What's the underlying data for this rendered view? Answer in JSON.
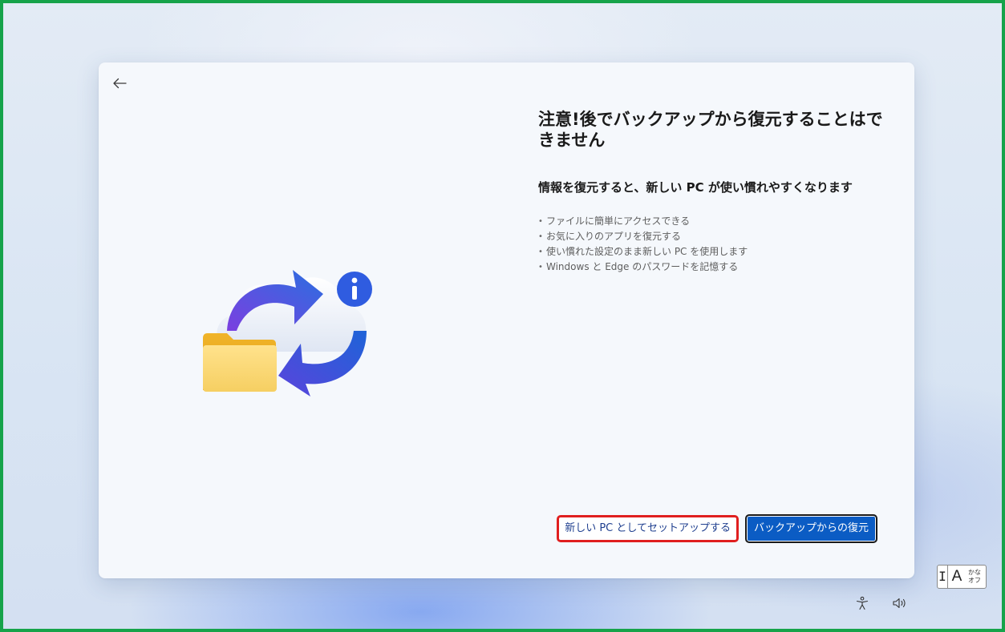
{
  "dialog": {
    "title": "注意!後でバックアップから復元することはできません",
    "subtitle": "情報を復元すると、新しい PC が使い慣れやすくなります",
    "bullets": [
      "ファイルに簡単にアクセスできる",
      "お気に入りのアプリを復元する",
      "使い慣れた設定のまま新しい PC を使用します",
      "Windows と Edge のパスワードを記憶する"
    ],
    "secondary_button": "新しい PC としてセットアップする",
    "primary_button": "バックアップからの復元"
  },
  "ime": {
    "cursor_glyph": "I",
    "mode": "A",
    "kana_top": "かな",
    "kana_bottom": "オフ"
  },
  "icons": {
    "back": "back-arrow-icon",
    "illustration": "restore-backup-illustration",
    "accessibility": "accessibility-icon",
    "volume": "volume-icon"
  },
  "colors": {
    "highlight_border": "#e01f1f",
    "primary_button": "#0b5cc4",
    "frame_border": "#16a34a"
  }
}
